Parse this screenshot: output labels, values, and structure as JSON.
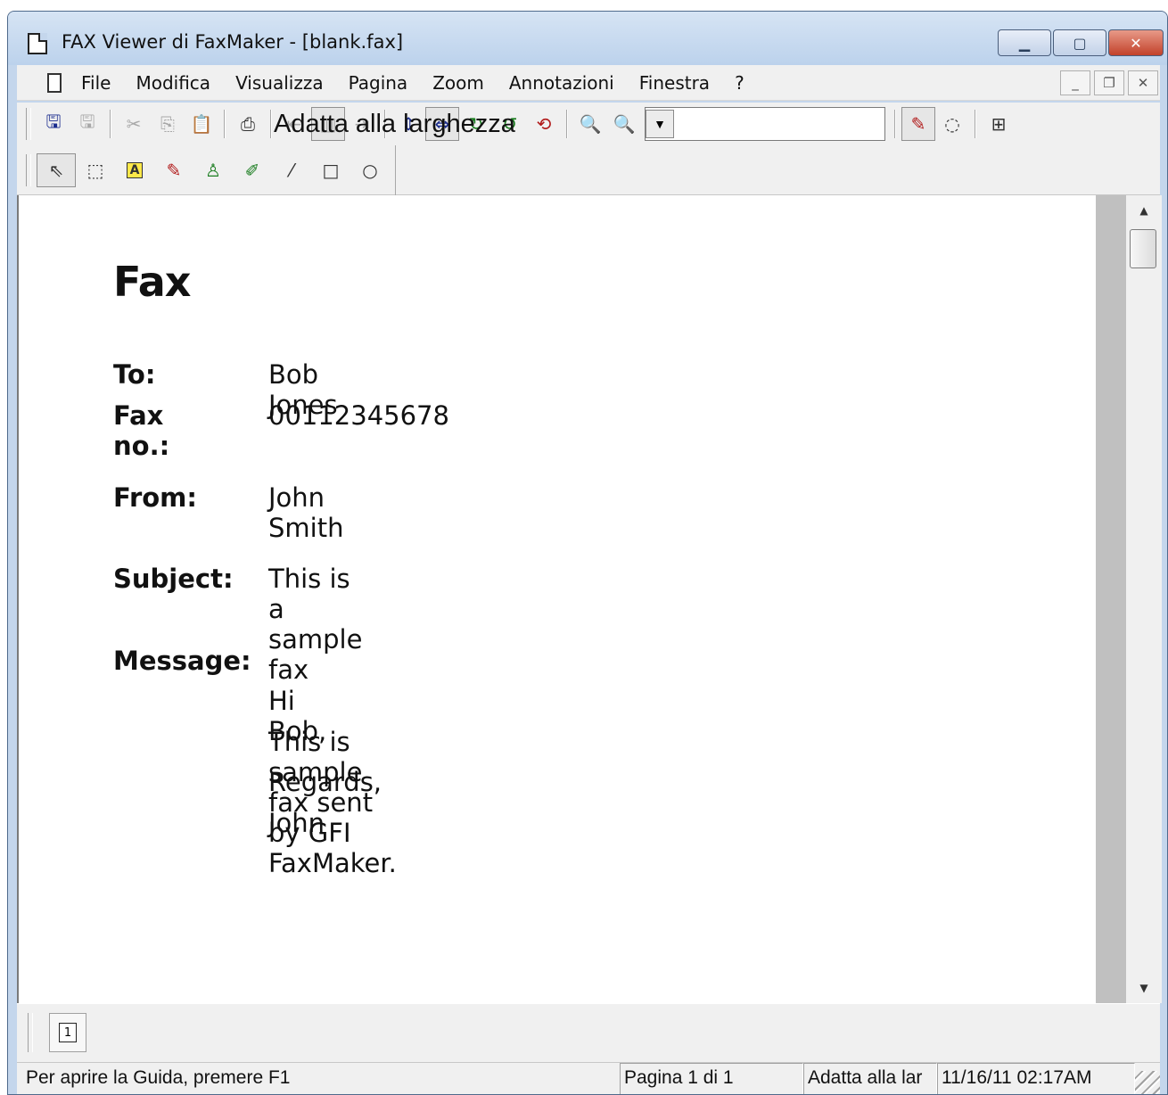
{
  "window": {
    "title": "FAX Viewer di FaxMaker - [blank.fax]",
    "caption_buttons": [
      "minimize",
      "maximize",
      "close"
    ]
  },
  "menu": {
    "items": [
      "File",
      "Modifica",
      "Visualizza",
      "Pagina",
      "Zoom",
      "Annotazioni",
      "Finestra",
      "?"
    ]
  },
  "toolbar": {
    "buttons": [
      {
        "icon": "save-icon"
      },
      {
        "icon": "save-as-icon"
      },
      {
        "icon": "cut-icon"
      },
      {
        "icon": "copy-icon"
      },
      {
        "icon": "paste-icon"
      },
      {
        "icon": "print-icon"
      },
      {
        "icon": "previous-page-icon"
      },
      {
        "icon": "page-number-icon"
      },
      {
        "icon": "next-page-icon"
      },
      {
        "icon": "fit-height-icon"
      },
      {
        "icon": "fit-width-icon"
      },
      {
        "icon": "rotate-right-icon"
      },
      {
        "icon": "rotate-left-icon"
      },
      {
        "icon": "flip-icon"
      },
      {
        "icon": "zoom-out-icon"
      },
      {
        "icon": "zoom-in-icon"
      },
      {
        "icon": "annotate-pen-icon"
      },
      {
        "icon": "lasso-icon"
      },
      {
        "icon": "thumbnails-icon"
      }
    ],
    "zoom_value": "Adatta alla larghezza"
  },
  "annotation_toolbar": {
    "tools": [
      "select-arrow-icon",
      "rectangle-select-icon",
      "text-annotation-icon",
      "highlighter-icon",
      "stamp-icon",
      "marker-icon",
      "line-icon",
      "rectangle-icon",
      "ellipse-icon"
    ]
  },
  "fax": {
    "heading": "Fax",
    "to_label": "To:",
    "to_value": "Bob Jones",
    "faxno_label": "Fax no.:",
    "faxno_value": "00112345678",
    "from_label": "From:",
    "from_value": "John Smith",
    "subject_label": "Subject:",
    "subject_value": "This is a sample fax",
    "message_label": "Message:",
    "message_lines": [
      "Hi Bob,",
      "This is sample fax sent by GFI FaxMaker.",
      "Regards,",
      "John"
    ]
  },
  "page_tabs": {
    "current": "1"
  },
  "status": {
    "help": "Per aprire la Guida, premere F1",
    "page": "Pagina 1 di 1",
    "zoom": "Adatta alla lar",
    "datetime": "11/16/11 02:17AM"
  }
}
